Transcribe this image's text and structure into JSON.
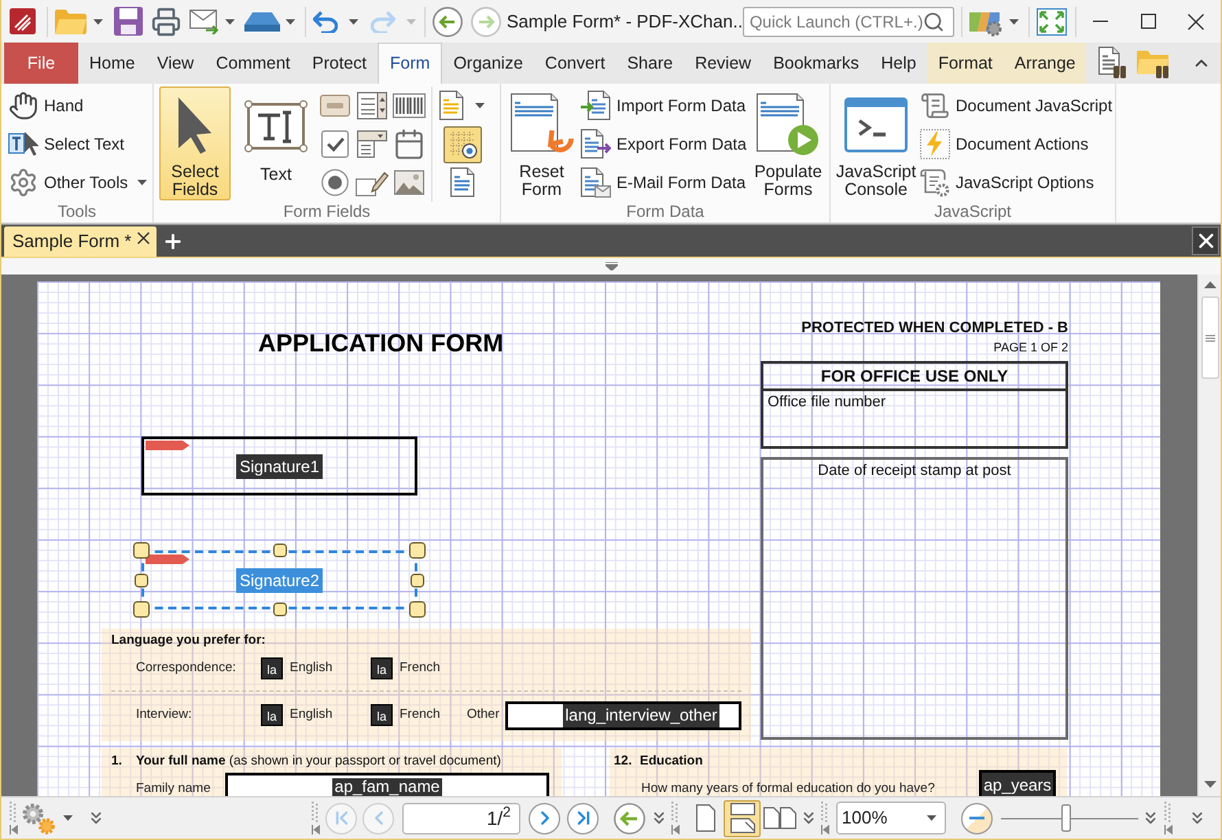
{
  "title_bar": {
    "title": "Sample Form* - PDF-XChan..",
    "redo_disabled": true,
    "forward_disabled": true,
    "quick_launch": {
      "placeholder": "Quick Launch (CTRL+.)"
    }
  },
  "ribbon_tabs": [
    {
      "label": "File",
      "kind": "file",
      "selected": false
    },
    {
      "label": "Home",
      "kind": "tab",
      "selected": false
    },
    {
      "label": "View",
      "kind": "tab",
      "selected": false
    },
    {
      "label": "Comment",
      "kind": "tab",
      "selected": false
    },
    {
      "label": "Protect",
      "kind": "tab",
      "selected": false
    },
    {
      "label": "Form",
      "kind": "tab",
      "selected": true
    },
    {
      "label": "Organize",
      "kind": "tab",
      "selected": false
    },
    {
      "label": "Convert",
      "kind": "tab",
      "selected": false
    },
    {
      "label": "Share",
      "kind": "tab",
      "selected": false
    },
    {
      "label": "Review",
      "kind": "tab",
      "selected": false
    },
    {
      "label": "Bookmarks",
      "kind": "tab",
      "selected": false
    },
    {
      "label": "Help",
      "kind": "tab",
      "selected": false
    },
    {
      "label": "Format",
      "kind": "contextual",
      "selected": false
    },
    {
      "label": "Arrange",
      "kind": "contextual",
      "selected": false
    }
  ],
  "ribbon": {
    "tools": {
      "title": "Tools",
      "items": [
        {
          "label": "Hand",
          "kind": "tool"
        },
        {
          "label": "Select Text",
          "kind": "tool"
        },
        {
          "label": "Other Tools",
          "kind": "menu"
        }
      ]
    },
    "form_fields": {
      "title": "Form Fields",
      "big_buttons": [
        {
          "label": "Select Fields",
          "selected": true
        },
        {
          "label": "Text",
          "selected": false
        }
      ],
      "grid_toggle": {
        "on": true
      }
    },
    "form_data": {
      "title": "Form Data",
      "big_buttons": [
        {
          "label": "Reset Form"
        },
        {
          "label": "Populate Forms"
        }
      ],
      "items": [
        {
          "label": "Import Form Data"
        },
        {
          "label": "Export Form Data"
        },
        {
          "label": "E-Mail Form Data"
        }
      ]
    },
    "javascript": {
      "title": "JavaScript",
      "big_buttons": [
        {
          "label": "JavaScript Console"
        }
      ],
      "items": [
        {
          "label": "Document JavaScript"
        },
        {
          "label": "Document Actions"
        },
        {
          "label": "JavaScript Options"
        }
      ]
    }
  },
  "document_tabs": [
    {
      "label": "Sample Form *",
      "selected": true
    }
  ],
  "page": {
    "title": "APPLICATION FORM",
    "protected_note": "PROTECTED WHEN COMPLETED - B",
    "page_label": "PAGE 1 OF 2",
    "office_box": {
      "heading": "FOR OFFICE USE ONLY",
      "field_label": "Office file number"
    },
    "receipt_box": {
      "label": "Date of receipt stamp at post"
    },
    "signature_fields": [
      {
        "name": "Signature1",
        "selected": false
      },
      {
        "name": "Signature2",
        "selected": true
      }
    ],
    "language_section": {
      "heading": "Language you prefer for:",
      "rows": [
        {
          "label": "Correspondence:",
          "options": [
            {
              "field_name": "la",
              "label": "English"
            },
            {
              "field_name": "la",
              "label": "French"
            }
          ]
        },
        {
          "label": "Interview:",
          "options": [
            {
              "field_name": "la",
              "label": "English"
            },
            {
              "field_name": "la",
              "label": "French"
            }
          ],
          "other": {
            "label": "Other",
            "field_name": "lang_interview_other"
          }
        }
      ]
    },
    "sections": [
      {
        "kind": "name",
        "number": "1.",
        "heading": "**Your full name** (as shown in your passport or travel document)",
        "field_label": "Family name",
        "field_name": "ap_fam_name"
      },
      {
        "kind": "question",
        "number": "12.",
        "heading": "Education",
        "field_label": "How many years of formal education do you have?",
        "field_name": "ap_years"
      }
    ]
  },
  "status_bar": {
    "page_nav": [
      {
        "kind": "first",
        "disabled": true
      },
      {
        "kind": "previous",
        "disabled": true
      },
      {
        "kind": "next",
        "disabled": false
      },
      {
        "kind": "last",
        "disabled": false
      }
    ],
    "page_field": {
      "value": "1/$^{2}$"
    },
    "page_layouts": [
      {
        "kind": "single",
        "selected": false
      },
      {
        "kind": "continuous",
        "selected": true
      },
      {
        "kind": "facing",
        "selected": false
      }
    ],
    "zoom_field": {
      "value": "100%"
    },
    "zoom_slider": {
      "level": 0.47
    }
  }
}
